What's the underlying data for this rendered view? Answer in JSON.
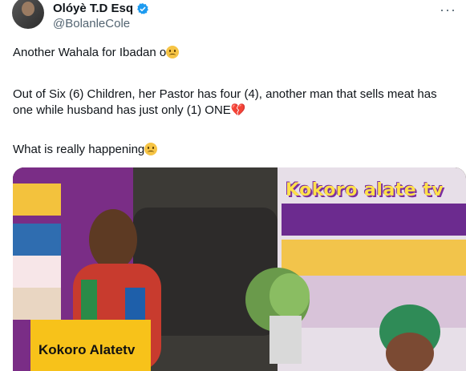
{
  "author": {
    "name": "Olóyè T.D Esq",
    "handle": "@BolanleCole"
  },
  "tweet": {
    "line1": "Another Wahala for Ibadan o",
    "line2": "Out of Six (6) Children, her Pastor has four (4), another man that sells meat has one while husband has just only (1) ONE",
    "line3": "What is really happening"
  },
  "video": {
    "overlay_brand": "Kokoro alate tv",
    "lower_label": "Kokoro Alatetv"
  },
  "icons": {
    "verified": "verified-badge-icon",
    "more": "more-options-icon",
    "face": "sad-face-emoji",
    "heart": "broken-heart-emoji"
  },
  "colors": {
    "verified": "#1d9bf0",
    "text": "#0f1419",
    "secondary": "#536471",
    "label_bg": "#f7c21a"
  }
}
